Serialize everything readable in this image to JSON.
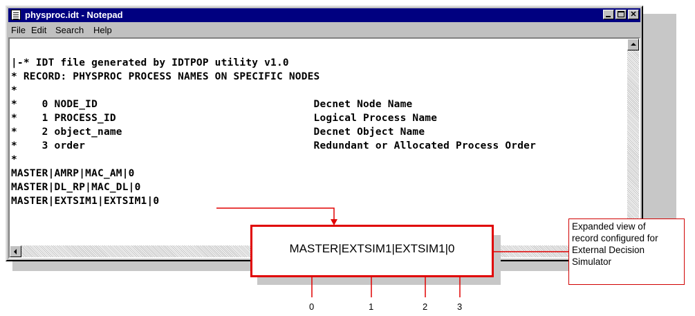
{
  "window": {
    "title": "physproc.idt - Notepad",
    "menu": [
      "File",
      "Edit",
      "Search",
      "Help"
    ]
  },
  "document": {
    "lines": [
      "|-* IDT file generated by IDTPOP utility v1.0",
      "* RECORD: PHYSPROC PROCESS NAMES ON SPECIFIC NODES",
      "*",
      "*    0 NODE_ID                                   Decnet Node Name",
      "*    1 PROCESS_ID                                Logical Process Name",
      "*    2 object_name                               Decnet Object Name",
      "*    3 order                                     Redundant or Allocated Process Order",
      "*",
      "MASTER|AMRP|MAC_AM|0",
      "MASTER|DL_RP|MAC_DL|0",
      "MASTER|EXTSIM1|EXTSIM1|0"
    ]
  },
  "callout": {
    "expanded_record": "MASTER|EXTSIM1|EXTSIM1|0",
    "note_lines": [
      "Expanded view of",
      "record configured for",
      "External Decision",
      "Simulator"
    ],
    "field_indices": [
      "0",
      "1",
      "2",
      "3"
    ],
    "accent_color": "#e00000"
  }
}
